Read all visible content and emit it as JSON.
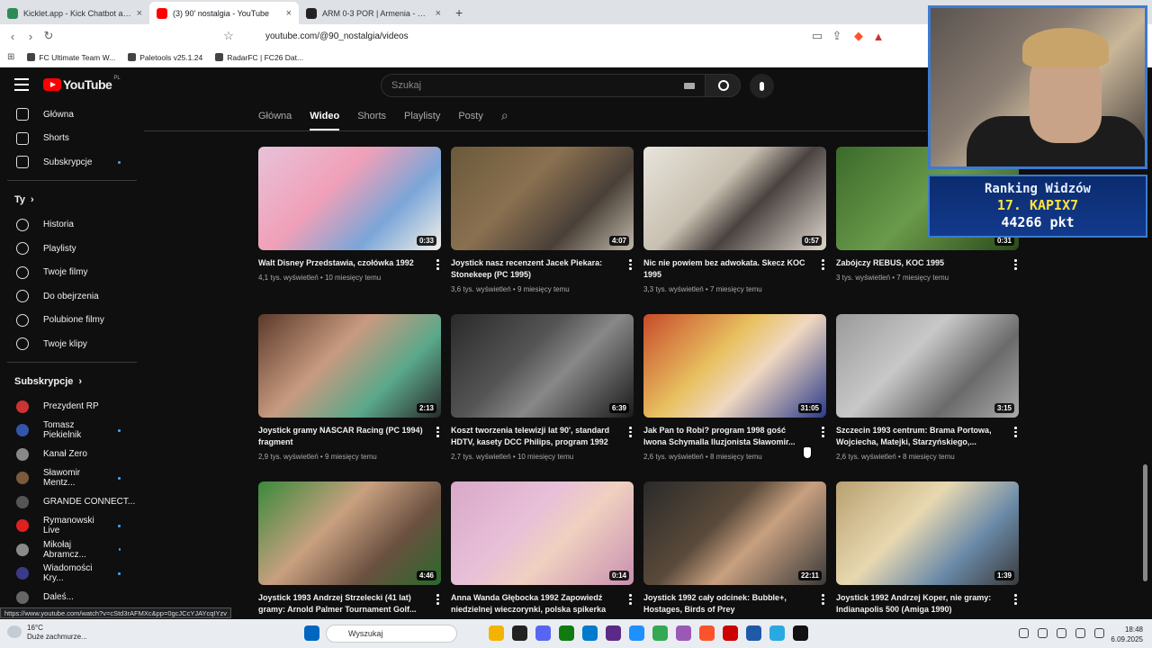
{
  "browser": {
    "tabs": [
      {
        "title": "Kicklet.app - Kick Chatbot and Overl",
        "fav": "#2e8b57"
      },
      {
        "title": "(3) 90' nostalgia - YouTube",
        "fav": "#ff0000"
      },
      {
        "title": "ARM 0-3 POR | Armenia - Portugal -",
        "fav": "#222222"
      }
    ],
    "url": "youtube.com/@90_nostalgia/videos",
    "bookmarks": [
      "FC Ultimate Team W...",
      "Paletools v25.1.24",
      "RadarFC | FC26 Dat..."
    ]
  },
  "youtube": {
    "logo": "YouTube",
    "region": "PL",
    "search_placeholder": "Szukaj",
    "sidebar_main": [
      {
        "label": "Główna",
        "icon": "home-icon"
      },
      {
        "label": "Shorts",
        "icon": "shorts-icon"
      },
      {
        "label": "Subskrypcje",
        "icon": "subscriptions-icon",
        "dot": true
      }
    ],
    "you_heading": "Ty",
    "sidebar_you": [
      {
        "label": "Historia",
        "icon": "history-icon"
      },
      {
        "label": "Playlisty",
        "icon": "playlists-icon"
      },
      {
        "label": "Twoje filmy",
        "icon": "your-videos-icon"
      },
      {
        "label": "Do obejrzenia",
        "icon": "watch-later-icon"
      },
      {
        "label": "Polubione filmy",
        "icon": "liked-icon"
      },
      {
        "label": "Twoje klipy",
        "icon": "clips-icon"
      }
    ],
    "subs_heading": "Subskrypcje",
    "subscriptions": [
      {
        "label": "Prezydent RP",
        "color": "#c33",
        "dot": false
      },
      {
        "label": "Tomasz Piekielnik",
        "color": "#3355aa",
        "dot": true
      },
      {
        "label": "Kanał Zero",
        "color": "#888",
        "dot": false
      },
      {
        "label": "Sławomir Mentz...",
        "color": "#7a5a3a",
        "dot": true
      },
      {
        "label": "GRANDE CONNECT...",
        "color": "#555",
        "dot": false
      },
      {
        "label": "Rymanowski Live",
        "color": "#e02020",
        "dot": true
      },
      {
        "label": "Mikołaj Abramcz...",
        "color": "#8a8a8a",
        "dot": true
      },
      {
        "label": "Wiadomości Kry...",
        "color": "#3a3a8a",
        "dot": true
      },
      {
        "label": "Daleś...",
        "color": "#666",
        "dot": false
      }
    ],
    "channel_tabs": [
      "Główna",
      "Wideo",
      "Shorts",
      "Playlisty",
      "Posty"
    ],
    "active_tab": "Wideo",
    "videos": [
      {
        "title": "Walt Disney Przedstawia, czołówka 1992",
        "meta": "4,1 tys. wyświetleń • 10 miesięcy temu",
        "dur": "0:33",
        "bg": "linear-gradient(135deg,#e7c2d8,#f0a0b8 40%,#7aa6d8 70%,#f4f0e8)"
      },
      {
        "title": "Joystick nasz recenzent Jacek Piekara: Stonekeep (PC 1995)",
        "meta": "3,6 tys. wyświetleń • 9 miesięcy temu",
        "dur": "4:07",
        "bg": "linear-gradient(135deg,#6a5a3a,#8a7050 40%,#4a4038 70%,#bfb8a8)"
      },
      {
        "title": "Nic nie powiem bez adwokata. Skecz KOC 1995",
        "meta": "3,3 tys. wyświetleń • 7 miesięcy temu",
        "dur": "0:57",
        "bg": "linear-gradient(135deg,#e8e4dc,#c8c0b0 40%,#4a4240 60%,#ddd6cc)"
      },
      {
        "title": "Zabójczy REBUS, KOC 1995",
        "meta": "3 tys. wyświetleń • 7 miesięcy temu",
        "dur": "0:31",
        "bg": "linear-gradient(135deg,#3a6a2a,#6a9a4a 50%,#2a4a1a)"
      },
      {
        "title": "Joystick gramy NASCAR Racing (PC 1994) fragment",
        "meta": "2,9 tys. wyświetleń • 9 miesięcy temu",
        "dur": "2:13",
        "bg": "linear-gradient(135deg,#5a3a2a,#c89a80 40%,#5aa88a 70%,#2a2a2a)"
      },
      {
        "title": "Koszt tworzenia telewizji lat 90', standard HDTV, kasety DCC Philips, program 1992",
        "meta": "2,7 tys. wyświetleń • 10 miesięcy temu",
        "dur": "6:39",
        "bg": "linear-gradient(135deg,#2a2a2a,#555 40%,#888 60%,#1a1a1a)"
      },
      {
        "title": "Jak Pan to Robi? program 1998 gość Iwona Schymalla Iluzjonista Sławomir...",
        "meta": "2,6 tys. wyświetleń • 8 miesięcy temu",
        "dur": "31:05",
        "bg": "linear-gradient(135deg,#c84a2a,#e8c060 40%,#f0d8c0 60%,#2a3a8a)"
      },
      {
        "title": "Szczecin 1993 centrum: Brama Portowa, Wojciecha, Matejki, Starzyńskiego,...",
        "meta": "2,6 tys. wyświetleń • 8 miesięcy temu",
        "dur": "3:15",
        "bg": "linear-gradient(135deg,#9a9a9a,#c8c8c8 40%,#6a6a6a 70%,#aaa)"
      },
      {
        "title": "Joystick 1993 Andrzej Strzelecki (41 lat) gramy: Arnold Palmer Tournament Golf...",
        "meta": "",
        "dur": "4:46",
        "bg": "linear-gradient(135deg,#3a8a3a,#c8a080 40%,#6a5040 70%,#2a6a2a)"
      },
      {
        "title": "Anna Wanda Głębocka 1992 Zapowiedź niedzielnej wieczorynki, polska spikerka",
        "meta": "",
        "dur": "0:14",
        "bg": "linear-gradient(135deg,#d8a8c8,#e8c0d8 40%,#f0d0c0 60%,#c890b0)"
      },
      {
        "title": "Joystick 1992 cały odcinek: Bubble+, Hostages, Birds of Prey",
        "meta": "",
        "dur": "22:11",
        "bg": "linear-gradient(135deg,#2a2a2a,#5a4a3a 40%,#c8a080 60%,#3a3a3a)"
      },
      {
        "title": "Joystick 1992 Andrzej Koper, nie gramy: Indianapolis 500 (Amiga 1990)",
        "meta": "",
        "dur": "1:39",
        "bg": "linear-gradient(135deg,#b8a070,#e8d8b0 40%,#6a8aa8 70%,#3a3a3a)"
      }
    ]
  },
  "overlay": {
    "rank_title": "Ranking Widzów",
    "rank_pos": "17. KAPIX7",
    "rank_pts": "44266 pkt"
  },
  "status_url": "https://www.youtube.com/watch?v=cStd3rAFMXc&pp=0gcJCcYJAYcqIYzv",
  "taskbar": {
    "temp": "16°C",
    "weather": "Duże zachmurze...",
    "search": "Wyszukaj",
    "time": "18:48",
    "date": "6.09.2025",
    "apps": [
      "#0067c0",
      "#444",
      "#f2b400",
      "#222",
      "#5865f2",
      "#107c10",
      "#007acc",
      "#5b2a86",
      "#1e90ff",
      "#34a853",
      "#9b59b6",
      "#fb542b",
      "#c00",
      "#1e5aa8",
      "#2aa9e0",
      "#111"
    ]
  }
}
